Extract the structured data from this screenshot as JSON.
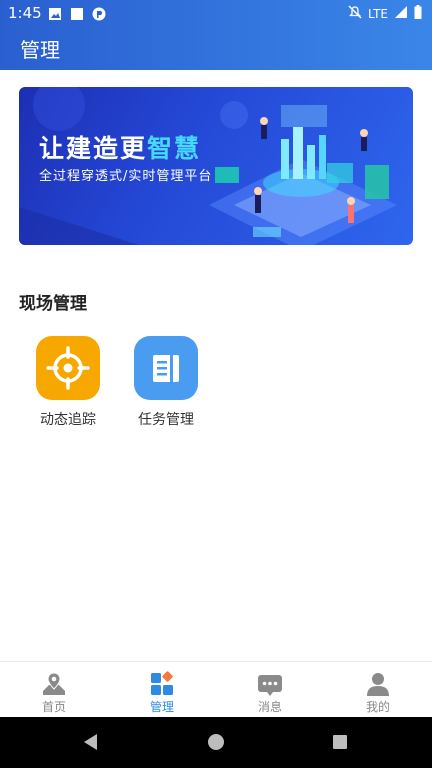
{
  "status_bar": {
    "time": "1:45",
    "network": "LTE"
  },
  "header": {
    "title": "管理"
  },
  "banner": {
    "headline_prefix": "让建造更",
    "headline_highlight": "智慧",
    "subtitle": "全过程穿透式/实时管理平台"
  },
  "section": {
    "title": "现场管理",
    "items": [
      {
        "label": "动态追踪",
        "icon": "target-icon",
        "color": "#f6a800"
      },
      {
        "label": "任务管理",
        "icon": "document-icon",
        "color": "#4a9cf0"
      }
    ]
  },
  "tabbar": {
    "tabs": [
      {
        "label": "首页",
        "icon": "map-pin-icon",
        "active": false
      },
      {
        "label": "管理",
        "icon": "grid-icon",
        "active": true
      },
      {
        "label": "消息",
        "icon": "message-icon",
        "active": false
      },
      {
        "label": "我的",
        "icon": "user-icon",
        "active": false
      }
    ]
  },
  "colors": {
    "accent": "#2f8ae6",
    "header_start": "#2a5fd0",
    "header_end": "#3a86e8"
  }
}
